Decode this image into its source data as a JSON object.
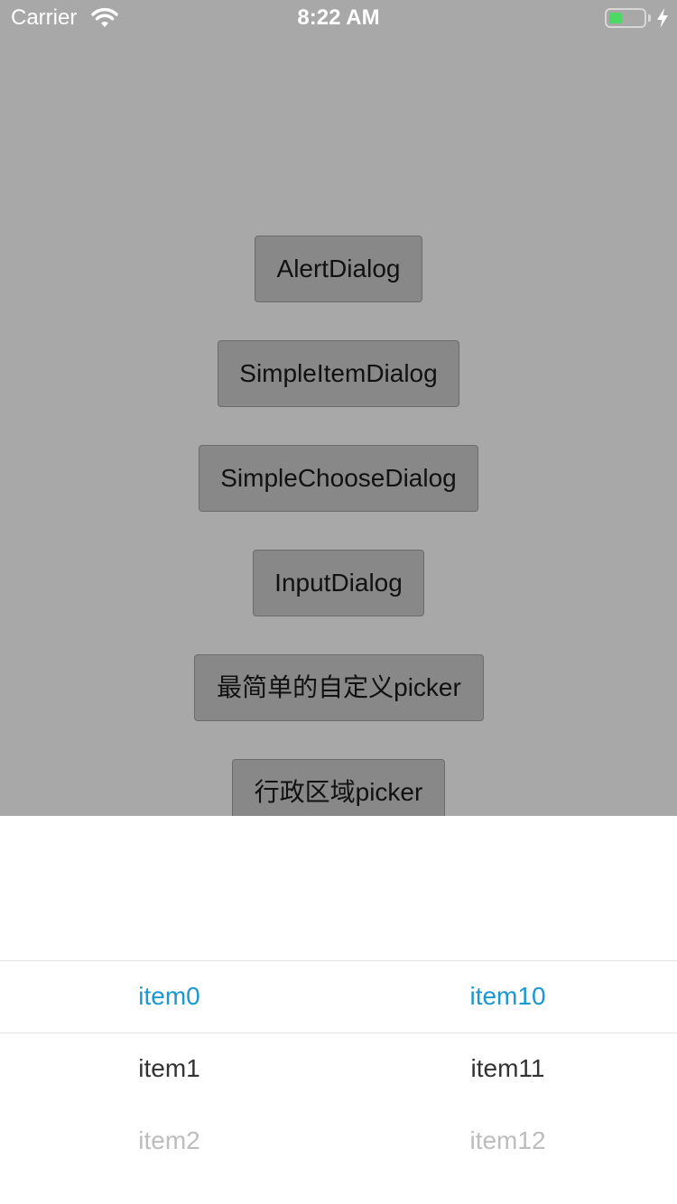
{
  "status_bar": {
    "carrier": "Carrier",
    "time": "8:22 AM",
    "battery_level": 0.4,
    "battery_color": "#4cd964"
  },
  "buttons": [
    {
      "label": "AlertDialog"
    },
    {
      "label": "SimpleItemDialog"
    },
    {
      "label": "SimpleChooseDialog"
    },
    {
      "label": "InputDialog"
    },
    {
      "label": "最简单的自定义picker"
    },
    {
      "label": "行政区域picker"
    }
  ],
  "picker": {
    "selected_color": "#1b97d1",
    "left_column": [
      "item0",
      "item1",
      "item2"
    ],
    "right_column": [
      "item10",
      "item11",
      "item12"
    ]
  }
}
